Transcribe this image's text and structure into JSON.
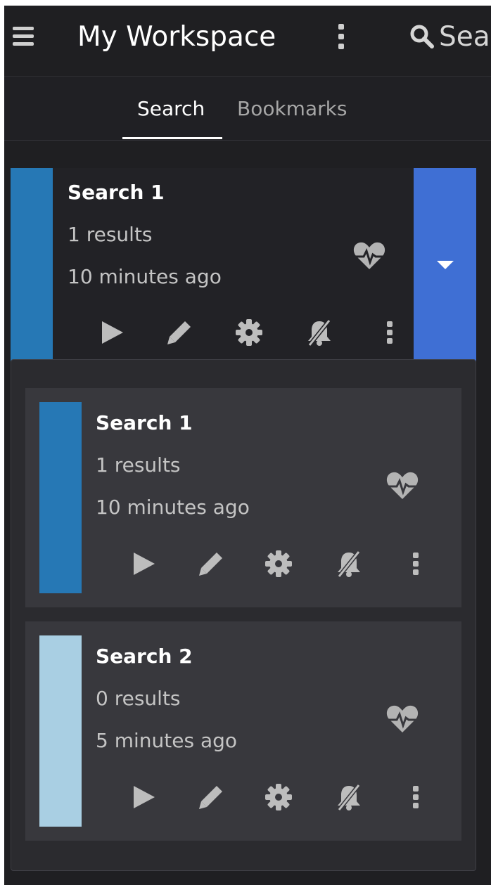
{
  "header": {
    "title": "My Workspace",
    "search_label": "Sea",
    "menu_icon": "hamburger-icon",
    "kebab_icon": "vertical-dots-icon",
    "search_icon": "search-icon"
  },
  "tabs": [
    {
      "label": "Search",
      "active": true
    },
    {
      "label": "Bookmarks",
      "active": false
    }
  ],
  "main_card": {
    "title": "Search 1",
    "results": "1 results",
    "time": "10 minutes ago",
    "color": "#2678b5",
    "expand_color": "#3f6fd4"
  },
  "dropdown": {
    "items": [
      {
        "title": "Search 1",
        "results": "1 results",
        "time": "10 minutes ago",
        "color": "#2678b5"
      },
      {
        "title": "Search 2",
        "results": "0 results",
        "time": "5 minutes ago",
        "color": "#a9cfe3"
      }
    ]
  },
  "actions": [
    "play-icon",
    "pencil-icon",
    "gear-icon",
    "bell-slash-icon",
    "vertical-dots-icon"
  ],
  "colors": {
    "background": "#1f1f22",
    "panel": "#2b2b2f",
    "subcard": "#38383d",
    "icon": "#bdbdbd"
  }
}
